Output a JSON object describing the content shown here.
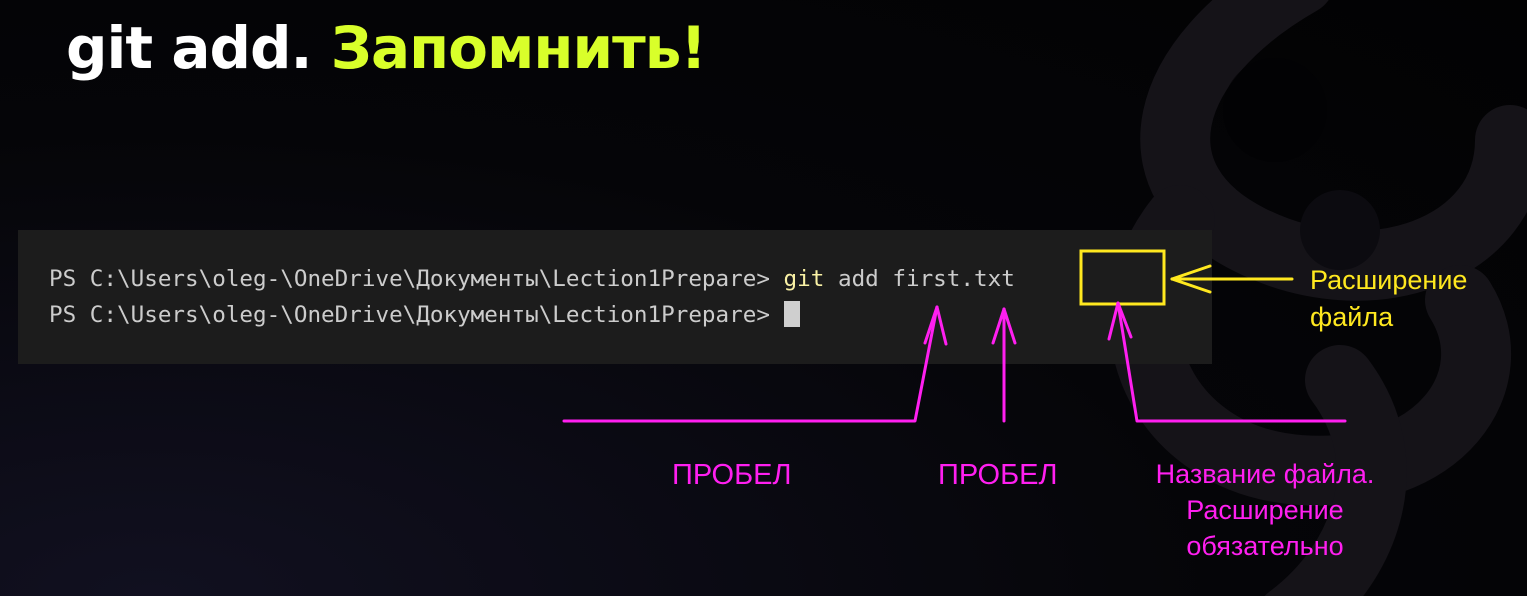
{
  "title": {
    "part1": "git add.",
    "part2": "Запомнить!"
  },
  "colors": {
    "accent": "#d9ff2a",
    "annotation_pink": "#ff1ff0",
    "annotation_yellow": "#ffe81f",
    "terminal_bg": "#1c1c1c",
    "command_highlight": "#f9f1a5"
  },
  "terminal": {
    "line1": {
      "prompt": "PS C:\\Users\\oleg-\\OneDrive\\Документы\\Lection1Prepare> ",
      "cmd": "git",
      "args": " add first.txt"
    },
    "line2": {
      "prompt": "PS C:\\Users\\oleg-\\OneDrive\\Документы\\Lection1Prepare> "
    }
  },
  "annotations": {
    "space_1": "ПРОБЕЛ",
    "space_2": "ПРОБЕЛ",
    "filename": [
      "Название файла.",
      "Расширение",
      "обязательно"
    ],
    "extension": [
      "Расширение",
      "файла"
    ]
  }
}
